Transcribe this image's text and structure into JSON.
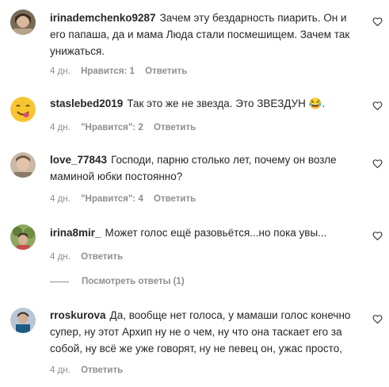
{
  "comments": [
    {
      "username": "irinademchenko9287",
      "text": "Зачем эту бездарность пиарить. Он и его папаша, да и мама Люда стали посмешищем. Зачем так унижаться.",
      "time": "4 дн.",
      "likes": "Нравится: 1",
      "reply": "Ответить"
    },
    {
      "username": "staslebed2019",
      "text": "Так это же не звезда. Это ЗВЕЗДУН 😂.",
      "time": "4 дн.",
      "likes": "\"Нравится\": 2",
      "reply": "Ответить"
    },
    {
      "username": "love_77843",
      "text": "Господи, парню столько лет, почему он возле маминой юбки постоянно?",
      "time": "4 дн.",
      "likes": "\"Нравится\": 4",
      "reply": "Ответить"
    },
    {
      "username": "irina8mir_",
      "text": "Может голос ещё разовьётся...но пока увы...",
      "time": "4 дн.",
      "reply": "Ответить",
      "view_replies": "Посмотреть ответы (1)"
    },
    {
      "username": "rroskurova",
      "text": "Да, вообще нет голоса, у мамаши голос конечно супер, ну этот Архип ну не о чем, ну что она таскает его за собой, ну всё же уже говорят, ну не певец он, ужас просто,",
      "time": "4 дн.",
      "reply": "Ответить"
    }
  ],
  "colors": {
    "text": "#262626",
    "secondary": "#8e8e8e"
  },
  "icons": [
    "heart-icon"
  ]
}
